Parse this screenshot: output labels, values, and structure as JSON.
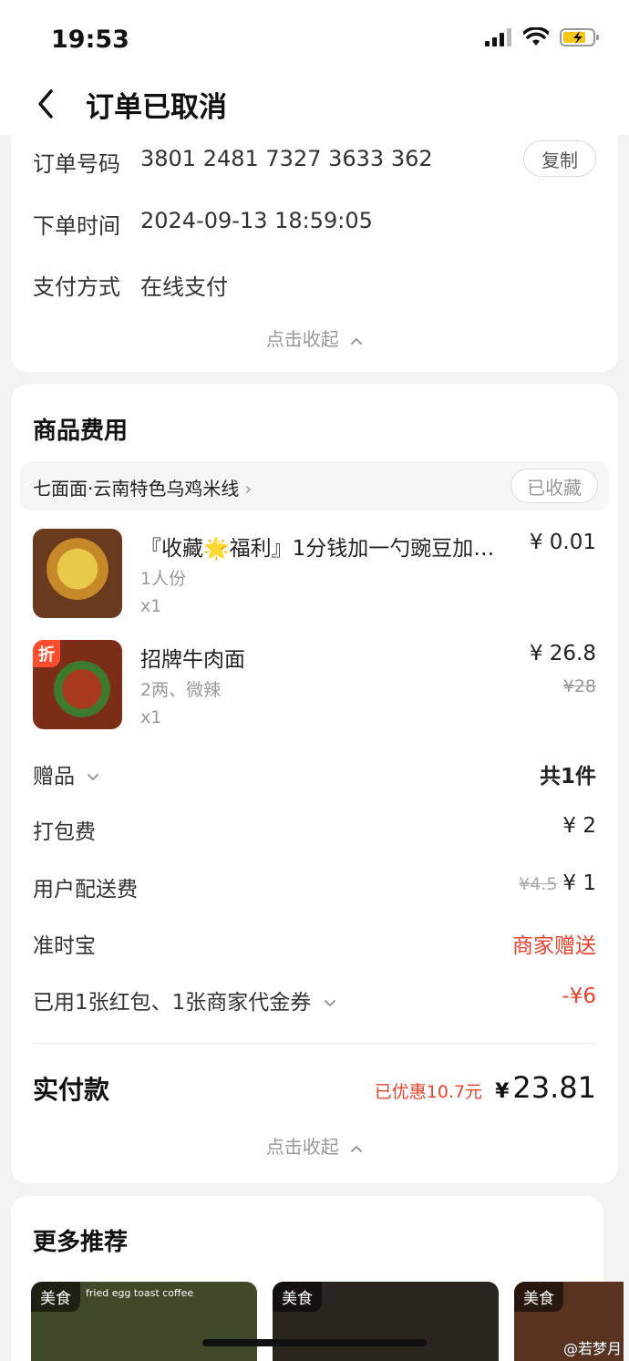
{
  "status_bar": {
    "time": "19:53"
  },
  "header": {
    "title": "订单已取消"
  },
  "order_info": {
    "order_number_label": "订单号码",
    "order_number": "3801 2481 7327 3633 362",
    "copy_label": "复制",
    "order_time_label": "下单时间",
    "order_time": "2024-09-13 18:59:05",
    "payment_label": "支付方式",
    "payment_value": "在线支付",
    "collapse_label": "点击收起"
  },
  "goods": {
    "section_title": "商品费用",
    "store_name": "七面面·云南特色乌鸡米线",
    "fav_label": "已收藏",
    "items": [
      {
        "name": "『收藏🌟福利』1分钱加一勺豌豆加…",
        "spec": "1人份",
        "qty": "x1",
        "price": "¥ 0.01",
        "orig_price": "",
        "tag": ""
      },
      {
        "name": "招牌牛肉面",
        "spec": "2两、微辣",
        "qty": "x1",
        "price": "¥ 26.8",
        "orig_price": "¥28",
        "tag": "折"
      }
    ],
    "fees": {
      "gift_label": "赠品",
      "gift_value": "共1件",
      "packing_label": "打包费",
      "packing_value": "¥ 2",
      "delivery_label": "用户配送费",
      "delivery_orig": "¥4.5",
      "delivery_value": "¥ 1",
      "ontime_label": "准时宝",
      "ontime_value": "商家赠送",
      "coupon_label": "已用1张红包、1张商家代金券",
      "coupon_value": "-¥6"
    },
    "total": {
      "label": "实付款",
      "saved": "已优惠10.7元",
      "yen": "¥",
      "amount": "23.81"
    },
    "collapse_label": "点击收起"
  },
  "recommend": {
    "section_title": "更多推荐",
    "cards": [
      {
        "tag": "美食",
        "text": "fried egg toast coffee",
        "color": "#3f4a2a"
      },
      {
        "tag": "美食",
        "text": "",
        "color": "#2b2520"
      },
      {
        "tag": "美食",
        "text": "",
        "color": "#5a3320"
      }
    ]
  },
  "watermark": "@若梦月",
  "colors": {
    "accent_red": "#e8432e",
    "discount_tag": "#ff4d2e"
  }
}
